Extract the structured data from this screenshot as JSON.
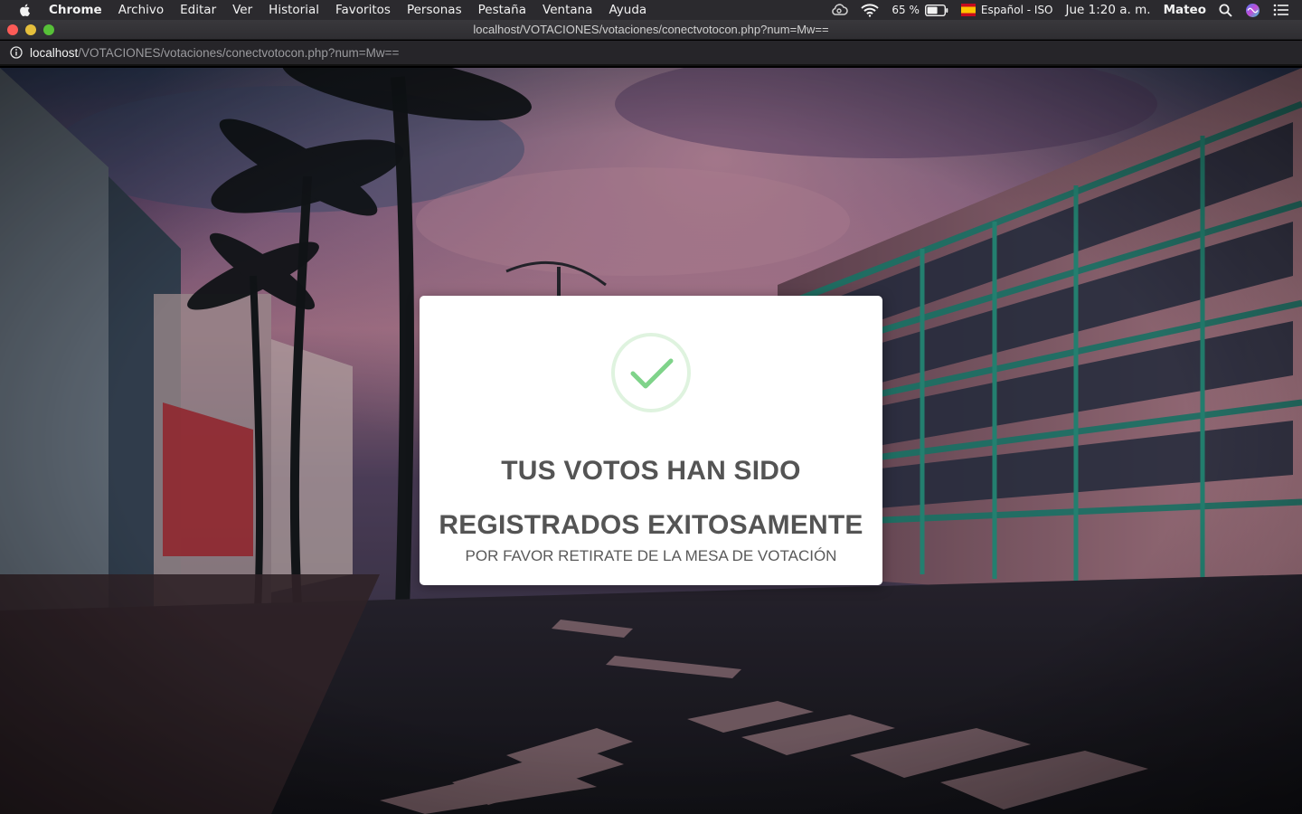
{
  "menubar": {
    "apple_icon": "apple-logo-icon",
    "items": [
      "Chrome",
      "Archivo",
      "Editar",
      "Ver",
      "Historial",
      "Favoritos",
      "Personas",
      "Pestaña",
      "Ventana",
      "Ayuda"
    ],
    "battery_percent": "65 %",
    "input_source": "Español - ISO",
    "clock": "Jue 1:20 a. m.",
    "user": "Mateo"
  },
  "window": {
    "title": "localhost/VOTACIONES/votaciones/conectvotocon.php?num=Mw=="
  },
  "address": {
    "host": "localhost",
    "path": "/VOTACIONES/votaciones/conectvotocon.php?num=Mw=="
  },
  "modal": {
    "icon": "success-check-icon",
    "title_line1": "TUS VOTOS HAN SIDO",
    "title_line2": "REGISTRADOS EXITOSAMENTE",
    "subtitle": "POR FAVOR RETIRATE DE LA MESA DE VOTACIÓN",
    "accent_color": "#7fd38a"
  }
}
